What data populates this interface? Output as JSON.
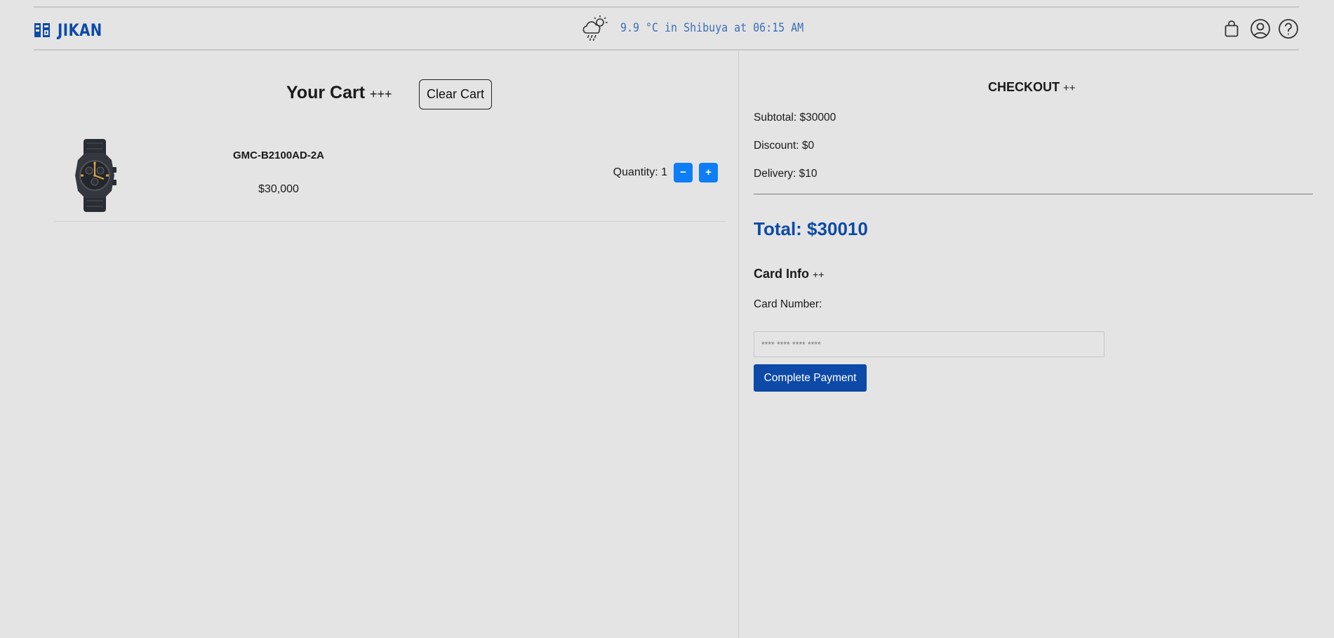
{
  "header": {
    "brand": "JIKAN",
    "weather_text": "9.9 °C in Shibuya at 06:15 AM",
    "icons": [
      "logo-mark-icon",
      "weather-icon",
      "shopping-bag-icon",
      "user-profile-icon",
      "help-icon"
    ],
    "brand_color": "#0d4aa8",
    "weather_color": "#3d6fb8"
  },
  "cart": {
    "title": "Your Cart",
    "title_suffix": "+++",
    "clear_label": "Clear Cart",
    "items": [
      {
        "name": "GMC-B2100AD-2A",
        "price": "$30,000",
        "quantity_label": "Quantity: 1",
        "decrement_label": "−",
        "increment_label": "+",
        "image_icon": "wristwatch-icon"
      }
    ],
    "button_color": "#0d7ef5"
  },
  "checkout": {
    "title": "CHECKOUT",
    "title_suffix": "++",
    "subtotal": "Subtotal: $30000",
    "discount": "Discount: $0",
    "delivery": "Delivery: $10",
    "total": "Total: $30010",
    "card_title": "Card Info",
    "card_title_suffix": "++",
    "card_number_label": "Card Number:",
    "card_placeholder": "**** **** **** ****",
    "pay_label": "Complete Payment",
    "accent_color": "#0d4aa8"
  }
}
